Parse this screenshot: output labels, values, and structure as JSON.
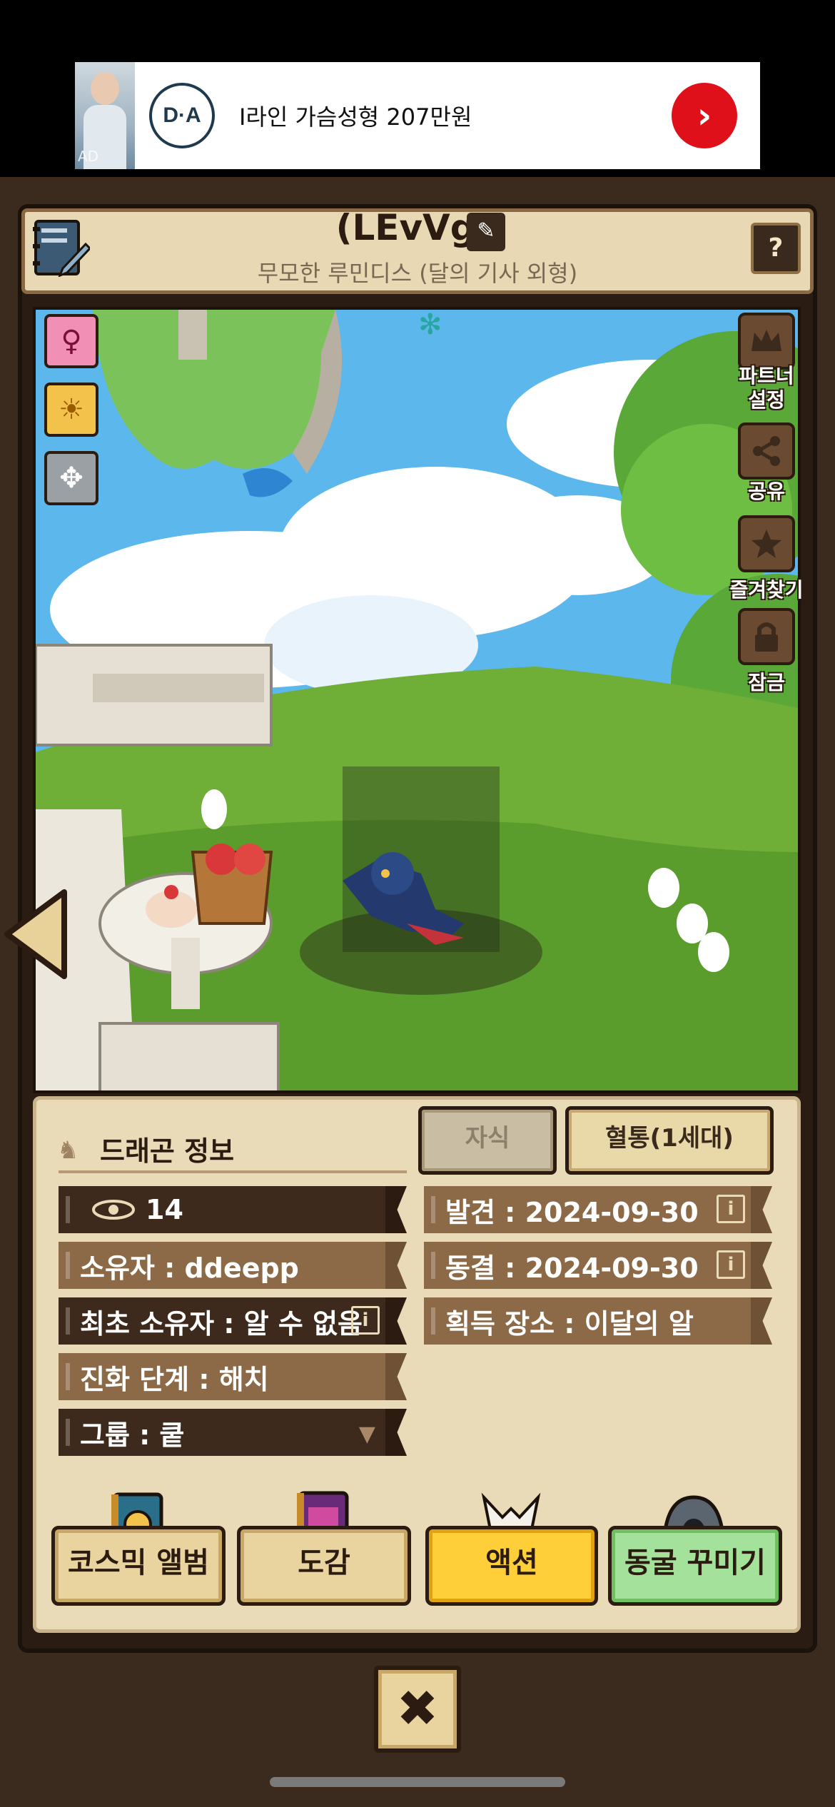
{
  "ad": {
    "logo_text": "D·A",
    "text": "I라인 가슴성형 207만원",
    "arrow": "›",
    "thumb_tag": "AD"
  },
  "header": {
    "name": "(LEvVg)",
    "subtitle": "무모한 루민디스 (달의 기사 외형)",
    "edit_icon": "✎",
    "help_label": "?"
  },
  "scene": {
    "gender_icon": "♀",
    "daytime_icon": "☀",
    "move_icon": "✥",
    "side_buttons": [
      {
        "label": "파트너\n설정",
        "icon": "crown-icon"
      },
      {
        "label": "공유",
        "icon": "share-icon"
      },
      {
        "label": "즐겨찾기",
        "icon": "star-icon"
      },
      {
        "label": "잠금",
        "icon": "lock-icon"
      }
    ]
  },
  "info": {
    "title": "드래곤 정보",
    "tabs": {
      "child": "자식",
      "lineage": "혈통(1세대)"
    },
    "views": "14",
    "owner": "소유자 : ddeepp",
    "first_owner": "최초 소유자 : 알 수 없음",
    "evolution": "진화 단계 : 해치",
    "group": "그룹 : 쿹",
    "discovered": "발견 : 2024-09-30",
    "frozen": "동결 : 2024-09-30",
    "obtained": "획득 장소 : 이달의 알",
    "info_icon_label": "i",
    "dropdown_icon": "▼"
  },
  "menu": {
    "album": "코스믹 앨범",
    "dex": "도감",
    "action": "액션",
    "cave": "동굴 꾸미기"
  },
  "close_label": "✖",
  "colors": {
    "frame_dark": "#2b1b10",
    "parchment": "#e9dab8",
    "action_yellow": "#ffcf3a",
    "cave_green": "#a4e19a"
  }
}
